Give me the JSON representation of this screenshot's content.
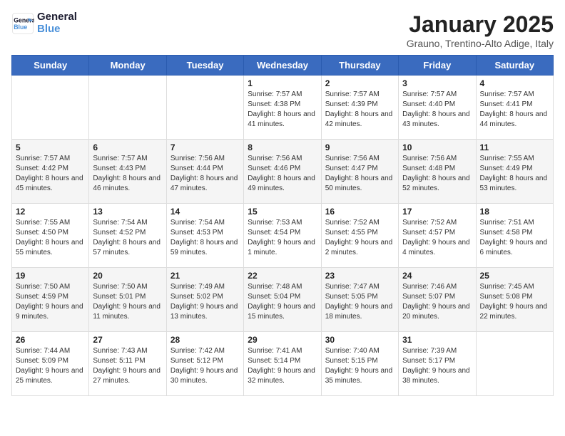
{
  "header": {
    "logo_line1": "General",
    "logo_line2": "Blue",
    "month": "January 2025",
    "location": "Grauno, Trentino-Alto Adige, Italy"
  },
  "weekdays": [
    "Sunday",
    "Monday",
    "Tuesday",
    "Wednesday",
    "Thursday",
    "Friday",
    "Saturday"
  ],
  "weeks": [
    [
      {
        "day": "",
        "sunrise": "",
        "sunset": "",
        "daylight": ""
      },
      {
        "day": "",
        "sunrise": "",
        "sunset": "",
        "daylight": ""
      },
      {
        "day": "",
        "sunrise": "",
        "sunset": "",
        "daylight": ""
      },
      {
        "day": "1",
        "sunrise": "7:57 AM",
        "sunset": "4:38 PM",
        "daylight": "8 hours and 41 minutes."
      },
      {
        "day": "2",
        "sunrise": "7:57 AM",
        "sunset": "4:39 PM",
        "daylight": "8 hours and 42 minutes."
      },
      {
        "day": "3",
        "sunrise": "7:57 AM",
        "sunset": "4:40 PM",
        "daylight": "8 hours and 43 minutes."
      },
      {
        "day": "4",
        "sunrise": "7:57 AM",
        "sunset": "4:41 PM",
        "daylight": "8 hours and 44 minutes."
      }
    ],
    [
      {
        "day": "5",
        "sunrise": "7:57 AM",
        "sunset": "4:42 PM",
        "daylight": "8 hours and 45 minutes."
      },
      {
        "day": "6",
        "sunrise": "7:57 AM",
        "sunset": "4:43 PM",
        "daylight": "8 hours and 46 minutes."
      },
      {
        "day": "7",
        "sunrise": "7:56 AM",
        "sunset": "4:44 PM",
        "daylight": "8 hours and 47 minutes."
      },
      {
        "day": "8",
        "sunrise": "7:56 AM",
        "sunset": "4:46 PM",
        "daylight": "8 hours and 49 minutes."
      },
      {
        "day": "9",
        "sunrise": "7:56 AM",
        "sunset": "4:47 PM",
        "daylight": "8 hours and 50 minutes."
      },
      {
        "day": "10",
        "sunrise": "7:56 AM",
        "sunset": "4:48 PM",
        "daylight": "8 hours and 52 minutes."
      },
      {
        "day": "11",
        "sunrise": "7:55 AM",
        "sunset": "4:49 PM",
        "daylight": "8 hours and 53 minutes."
      }
    ],
    [
      {
        "day": "12",
        "sunrise": "7:55 AM",
        "sunset": "4:50 PM",
        "daylight": "8 hours and 55 minutes."
      },
      {
        "day": "13",
        "sunrise": "7:54 AM",
        "sunset": "4:52 PM",
        "daylight": "8 hours and 57 minutes."
      },
      {
        "day": "14",
        "sunrise": "7:54 AM",
        "sunset": "4:53 PM",
        "daylight": "8 hours and 59 minutes."
      },
      {
        "day": "15",
        "sunrise": "7:53 AM",
        "sunset": "4:54 PM",
        "daylight": "9 hours and 1 minute."
      },
      {
        "day": "16",
        "sunrise": "7:52 AM",
        "sunset": "4:55 PM",
        "daylight": "9 hours and 2 minutes."
      },
      {
        "day": "17",
        "sunrise": "7:52 AM",
        "sunset": "4:57 PM",
        "daylight": "9 hours and 4 minutes."
      },
      {
        "day": "18",
        "sunrise": "7:51 AM",
        "sunset": "4:58 PM",
        "daylight": "9 hours and 6 minutes."
      }
    ],
    [
      {
        "day": "19",
        "sunrise": "7:50 AM",
        "sunset": "4:59 PM",
        "daylight": "9 hours and 9 minutes."
      },
      {
        "day": "20",
        "sunrise": "7:50 AM",
        "sunset": "5:01 PM",
        "daylight": "9 hours and 11 minutes."
      },
      {
        "day": "21",
        "sunrise": "7:49 AM",
        "sunset": "5:02 PM",
        "daylight": "9 hours and 13 minutes."
      },
      {
        "day": "22",
        "sunrise": "7:48 AM",
        "sunset": "5:04 PM",
        "daylight": "9 hours and 15 minutes."
      },
      {
        "day": "23",
        "sunrise": "7:47 AM",
        "sunset": "5:05 PM",
        "daylight": "9 hours and 18 minutes."
      },
      {
        "day": "24",
        "sunrise": "7:46 AM",
        "sunset": "5:07 PM",
        "daylight": "9 hours and 20 minutes."
      },
      {
        "day": "25",
        "sunrise": "7:45 AM",
        "sunset": "5:08 PM",
        "daylight": "9 hours and 22 minutes."
      }
    ],
    [
      {
        "day": "26",
        "sunrise": "7:44 AM",
        "sunset": "5:09 PM",
        "daylight": "9 hours and 25 minutes."
      },
      {
        "day": "27",
        "sunrise": "7:43 AM",
        "sunset": "5:11 PM",
        "daylight": "9 hours and 27 minutes."
      },
      {
        "day": "28",
        "sunrise": "7:42 AM",
        "sunset": "5:12 PM",
        "daylight": "9 hours and 30 minutes."
      },
      {
        "day": "29",
        "sunrise": "7:41 AM",
        "sunset": "5:14 PM",
        "daylight": "9 hours and 32 minutes."
      },
      {
        "day": "30",
        "sunrise": "7:40 AM",
        "sunset": "5:15 PM",
        "daylight": "9 hours and 35 minutes."
      },
      {
        "day": "31",
        "sunrise": "7:39 AM",
        "sunset": "5:17 PM",
        "daylight": "9 hours and 38 minutes."
      },
      {
        "day": "",
        "sunrise": "",
        "sunset": "",
        "daylight": ""
      }
    ]
  ]
}
